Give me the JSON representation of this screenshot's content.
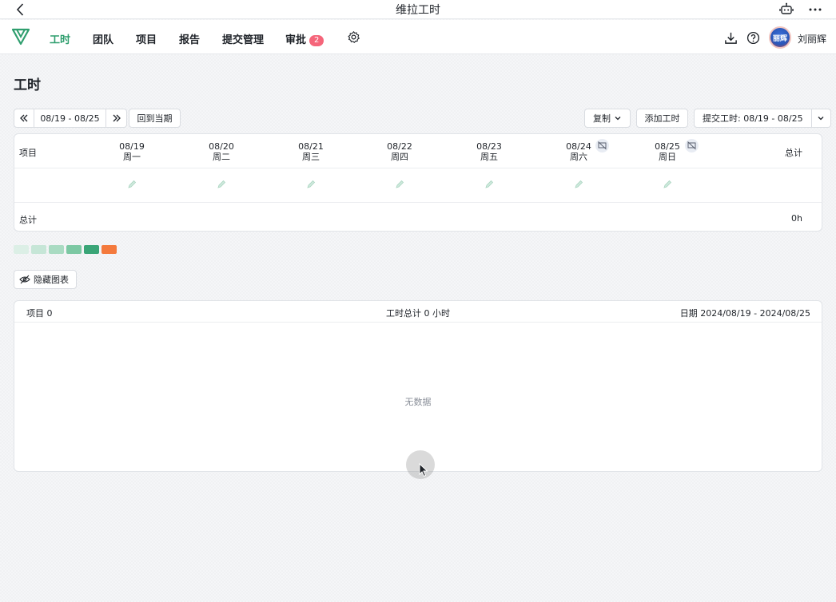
{
  "window": {
    "title": "维拉工时"
  },
  "nav": {
    "items": [
      {
        "label": "工时",
        "active": true
      },
      {
        "label": "团队"
      },
      {
        "label": "项目"
      },
      {
        "label": "报告"
      },
      {
        "label": "提交管理"
      },
      {
        "label": "审批",
        "badge": "2"
      }
    ],
    "user_name": "刘丽辉",
    "avatar_text": "丽辉"
  },
  "page": {
    "title": "工时",
    "date_range": "08/19 - 08/25",
    "today_btn": "回到当期",
    "copy_btn": "复制",
    "add_btn": "添加工时",
    "submit_btn": "提交工时: 08/19 - 08/25"
  },
  "week": {
    "project_header": "项目",
    "total_header": "总计",
    "days": [
      {
        "date": "08/19",
        "weekday": "周一"
      },
      {
        "date": "08/20",
        "weekday": "周二"
      },
      {
        "date": "08/21",
        "weekday": "周三"
      },
      {
        "date": "08/22",
        "weekday": "周四"
      },
      {
        "date": "08/23",
        "weekday": "周五"
      },
      {
        "date": "08/24",
        "weekday": "周六"
      },
      {
        "date": "08/25",
        "weekday": "周日"
      }
    ],
    "footer_label": "总计",
    "footer_total": "0h"
  },
  "legend_colors": [
    "#dcefe6",
    "#c6e6d7",
    "#a9dbc2",
    "#7cc8a3",
    "#3aa577",
    "#f47a3d"
  ],
  "hide_chart_btn": "隐藏图表",
  "summary": {
    "projects": "项目 0",
    "total": "工时总计 0 小时",
    "date": "日期 2024/08/19 - 2024/08/25",
    "empty": "无数据"
  }
}
